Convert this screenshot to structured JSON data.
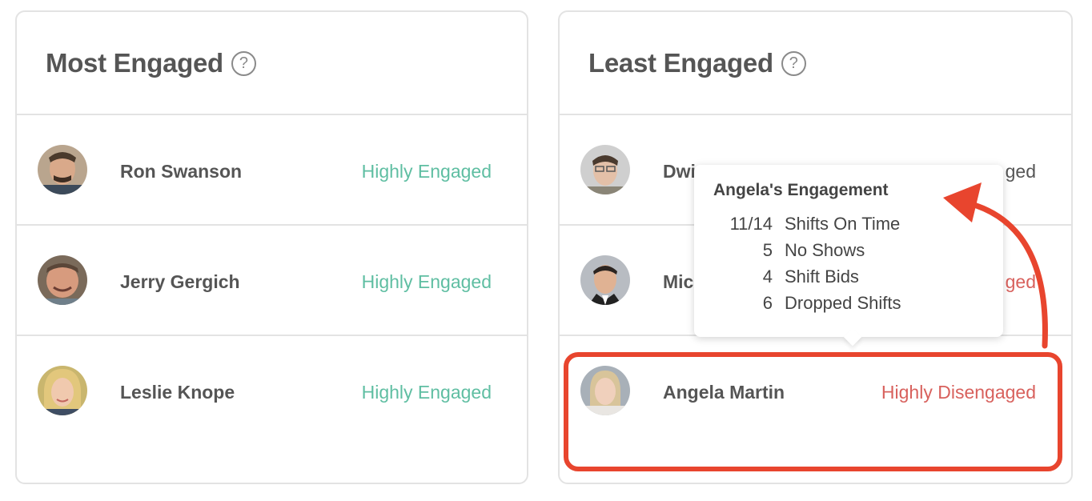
{
  "most_engaged": {
    "title": "Most Engaged",
    "help_icon": "?",
    "rows": [
      {
        "name": "Ron Swanson",
        "status": "Highly Engaged"
      },
      {
        "name": "Jerry Gergich",
        "status": "Highly Engaged"
      },
      {
        "name": "Leslie Knope",
        "status": "Highly Engaged"
      }
    ]
  },
  "least_engaged": {
    "title": "Least Engaged",
    "help_icon": "?",
    "rows": [
      {
        "name": "Dwi",
        "status": "ged"
      },
      {
        "name": "Mic",
        "status": "ged"
      },
      {
        "name": "Angela Martin",
        "status": "Highly Disengaged"
      }
    ]
  },
  "tooltip": {
    "title": "Angela's Engagement",
    "stats": [
      {
        "value": "11/14",
        "label": "Shifts On Time"
      },
      {
        "value": "5",
        "label": "No Shows"
      },
      {
        "value": "4",
        "label": "Shift Bids"
      },
      {
        "value": "6",
        "label": "Dropped Shifts"
      }
    ]
  },
  "colors": {
    "engaged": "#5fbea2",
    "disengaged": "#d8615d",
    "highlight": "#e8452e"
  }
}
